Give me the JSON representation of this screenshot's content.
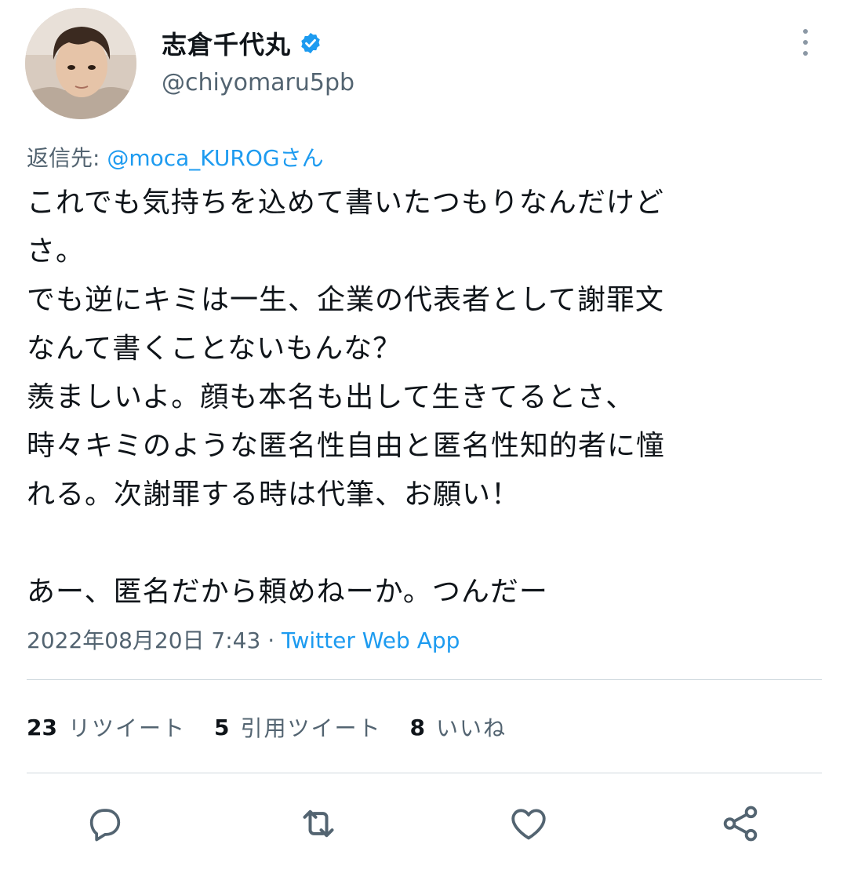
{
  "author": {
    "display_name": "志倉千代丸",
    "handle": "@chiyomaru5pb",
    "verified": true
  },
  "reply": {
    "prefix": "返信先: ",
    "mention": "@moca_KUROGさん"
  },
  "tweet": {
    "text": "これでも気持ちを込めて書いたつもりなんだけど\nさ。\nでも逆にキミは一生、企業の代表者として謝罪文\nなんて書くことないもんな？\n羨ましいよ。顔も本名も出して生きてるとさ、\n時々キミのような匿名性自由と匿名性知的者に憧\nれる。次謝罪する時は代筆、お願い！\n\nあー、匿名だから頼めねーか。つんだー"
  },
  "meta": {
    "timestamp": "2022年08月20日 7:43",
    "separator": " · ",
    "source": "Twitter Web App"
  },
  "stats": {
    "retweets": {
      "count": "23",
      "label": "リツイート"
    },
    "quotes": {
      "count": "5",
      "label": "引用ツイート"
    },
    "likes": {
      "count": "8",
      "label": "いいね"
    }
  },
  "icons": {
    "verified": "verified-badge-icon",
    "more": "more-vertical-icon",
    "reply": "reply-icon",
    "retweet": "retweet-icon",
    "like": "heart-icon",
    "share": "share-icon"
  },
  "colors": {
    "accent": "#1d9bf0",
    "text": "#0f1419",
    "secondary": "#536471",
    "divider": "#cfd9de",
    "action_icon": "#536471"
  }
}
